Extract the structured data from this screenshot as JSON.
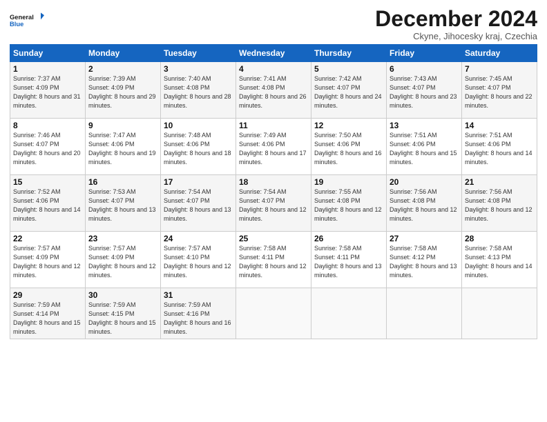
{
  "logo": {
    "line1": "General",
    "line2": "Blue"
  },
  "title": "December 2024",
  "subtitle": "Ckyne, Jihocesky kraj, Czechia",
  "weekdays": [
    "Sunday",
    "Monday",
    "Tuesday",
    "Wednesday",
    "Thursday",
    "Friday",
    "Saturday"
  ],
  "weeks": [
    [
      {
        "day": "1",
        "sunrise": "Sunrise: 7:37 AM",
        "sunset": "Sunset: 4:09 PM",
        "daylight": "Daylight: 8 hours and 31 minutes."
      },
      {
        "day": "2",
        "sunrise": "Sunrise: 7:39 AM",
        "sunset": "Sunset: 4:09 PM",
        "daylight": "Daylight: 8 hours and 29 minutes."
      },
      {
        "day": "3",
        "sunrise": "Sunrise: 7:40 AM",
        "sunset": "Sunset: 4:08 PM",
        "daylight": "Daylight: 8 hours and 28 minutes."
      },
      {
        "day": "4",
        "sunrise": "Sunrise: 7:41 AM",
        "sunset": "Sunset: 4:08 PM",
        "daylight": "Daylight: 8 hours and 26 minutes."
      },
      {
        "day": "5",
        "sunrise": "Sunrise: 7:42 AM",
        "sunset": "Sunset: 4:07 PM",
        "daylight": "Daylight: 8 hours and 24 minutes."
      },
      {
        "day": "6",
        "sunrise": "Sunrise: 7:43 AM",
        "sunset": "Sunset: 4:07 PM",
        "daylight": "Daylight: 8 hours and 23 minutes."
      },
      {
        "day": "7",
        "sunrise": "Sunrise: 7:45 AM",
        "sunset": "Sunset: 4:07 PM",
        "daylight": "Daylight: 8 hours and 22 minutes."
      }
    ],
    [
      {
        "day": "8",
        "sunrise": "Sunrise: 7:46 AM",
        "sunset": "Sunset: 4:07 PM",
        "daylight": "Daylight: 8 hours and 20 minutes."
      },
      {
        "day": "9",
        "sunrise": "Sunrise: 7:47 AM",
        "sunset": "Sunset: 4:06 PM",
        "daylight": "Daylight: 8 hours and 19 minutes."
      },
      {
        "day": "10",
        "sunrise": "Sunrise: 7:48 AM",
        "sunset": "Sunset: 4:06 PM",
        "daylight": "Daylight: 8 hours and 18 minutes."
      },
      {
        "day": "11",
        "sunrise": "Sunrise: 7:49 AM",
        "sunset": "Sunset: 4:06 PM",
        "daylight": "Daylight: 8 hours and 17 minutes."
      },
      {
        "day": "12",
        "sunrise": "Sunrise: 7:50 AM",
        "sunset": "Sunset: 4:06 PM",
        "daylight": "Daylight: 8 hours and 16 minutes."
      },
      {
        "day": "13",
        "sunrise": "Sunrise: 7:51 AM",
        "sunset": "Sunset: 4:06 PM",
        "daylight": "Daylight: 8 hours and 15 minutes."
      },
      {
        "day": "14",
        "sunrise": "Sunrise: 7:51 AM",
        "sunset": "Sunset: 4:06 PM",
        "daylight": "Daylight: 8 hours and 14 minutes."
      }
    ],
    [
      {
        "day": "15",
        "sunrise": "Sunrise: 7:52 AM",
        "sunset": "Sunset: 4:06 PM",
        "daylight": "Daylight: 8 hours and 14 minutes."
      },
      {
        "day": "16",
        "sunrise": "Sunrise: 7:53 AM",
        "sunset": "Sunset: 4:07 PM",
        "daylight": "Daylight: 8 hours and 13 minutes."
      },
      {
        "day": "17",
        "sunrise": "Sunrise: 7:54 AM",
        "sunset": "Sunset: 4:07 PM",
        "daylight": "Daylight: 8 hours and 13 minutes."
      },
      {
        "day": "18",
        "sunrise": "Sunrise: 7:54 AM",
        "sunset": "Sunset: 4:07 PM",
        "daylight": "Daylight: 8 hours and 12 minutes."
      },
      {
        "day": "19",
        "sunrise": "Sunrise: 7:55 AM",
        "sunset": "Sunset: 4:08 PM",
        "daylight": "Daylight: 8 hours and 12 minutes."
      },
      {
        "day": "20",
        "sunrise": "Sunrise: 7:56 AM",
        "sunset": "Sunset: 4:08 PM",
        "daylight": "Daylight: 8 hours and 12 minutes."
      },
      {
        "day": "21",
        "sunrise": "Sunrise: 7:56 AM",
        "sunset": "Sunset: 4:08 PM",
        "daylight": "Daylight: 8 hours and 12 minutes."
      }
    ],
    [
      {
        "day": "22",
        "sunrise": "Sunrise: 7:57 AM",
        "sunset": "Sunset: 4:09 PM",
        "daylight": "Daylight: 8 hours and 12 minutes."
      },
      {
        "day": "23",
        "sunrise": "Sunrise: 7:57 AM",
        "sunset": "Sunset: 4:09 PM",
        "daylight": "Daylight: 8 hours and 12 minutes."
      },
      {
        "day": "24",
        "sunrise": "Sunrise: 7:57 AM",
        "sunset": "Sunset: 4:10 PM",
        "daylight": "Daylight: 8 hours and 12 minutes."
      },
      {
        "day": "25",
        "sunrise": "Sunrise: 7:58 AM",
        "sunset": "Sunset: 4:11 PM",
        "daylight": "Daylight: 8 hours and 12 minutes."
      },
      {
        "day": "26",
        "sunrise": "Sunrise: 7:58 AM",
        "sunset": "Sunset: 4:11 PM",
        "daylight": "Daylight: 8 hours and 13 minutes."
      },
      {
        "day": "27",
        "sunrise": "Sunrise: 7:58 AM",
        "sunset": "Sunset: 4:12 PM",
        "daylight": "Daylight: 8 hours and 13 minutes."
      },
      {
        "day": "28",
        "sunrise": "Sunrise: 7:58 AM",
        "sunset": "Sunset: 4:13 PM",
        "daylight": "Daylight: 8 hours and 14 minutes."
      }
    ],
    [
      {
        "day": "29",
        "sunrise": "Sunrise: 7:59 AM",
        "sunset": "Sunset: 4:14 PM",
        "daylight": "Daylight: 8 hours and 15 minutes."
      },
      {
        "day": "30",
        "sunrise": "Sunrise: 7:59 AM",
        "sunset": "Sunset: 4:15 PM",
        "daylight": "Daylight: 8 hours and 15 minutes."
      },
      {
        "day": "31",
        "sunrise": "Sunrise: 7:59 AM",
        "sunset": "Sunset: 4:16 PM",
        "daylight": "Daylight: 8 hours and 16 minutes."
      },
      null,
      null,
      null,
      null
    ]
  ]
}
